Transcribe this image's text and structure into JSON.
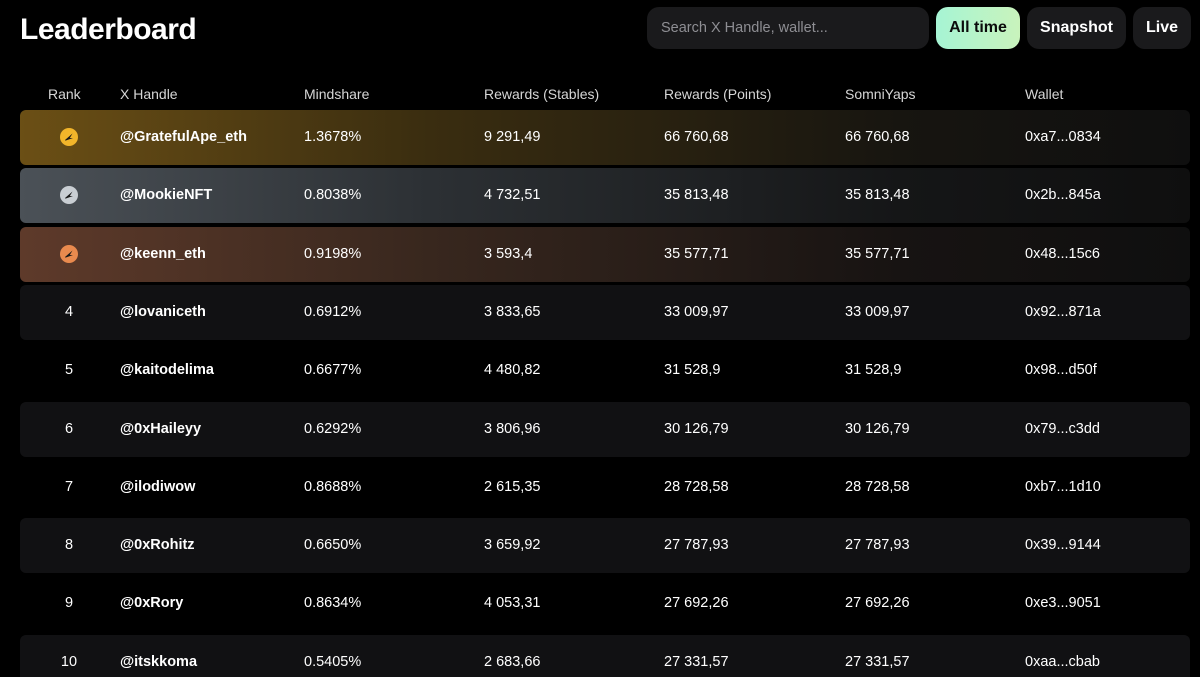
{
  "header": {
    "title": "Leaderboard",
    "search_placeholder": "Search X Handle, wallet...",
    "filters": [
      "All time",
      "Snapshot",
      "Live"
    ],
    "active_filter": "All time"
  },
  "table": {
    "columns": [
      "Rank",
      "X Handle",
      "Mindshare",
      "Rewards (Stables)",
      "Rewards (Points)",
      "SomniYaps",
      "Wallet"
    ],
    "rows": [
      {
        "rank": "1",
        "handle": "@GratefulApe_eth",
        "mindshare": "1.3678%",
        "stables": "9 291,49",
        "points": "66 760,68",
        "yaps": "66 760,68",
        "wallet": "0xa7...0834"
      },
      {
        "rank": "2",
        "handle": "@MookieNFT",
        "mindshare": "0.8038%",
        "stables": "4 732,51",
        "points": "35 813,48",
        "yaps": "35 813,48",
        "wallet": "0x2b...845a"
      },
      {
        "rank": "3",
        "handle": "@keenn_eth",
        "mindshare": "0.9198%",
        "stables": "3 593,4",
        "points": "35 577,71",
        "yaps": "35 577,71",
        "wallet": "0x48...15c6"
      },
      {
        "rank": "4",
        "handle": "@lovaniceth",
        "mindshare": "0.6912%",
        "stables": "3 833,65",
        "points": "33 009,97",
        "yaps": "33 009,97",
        "wallet": "0x92...871a"
      },
      {
        "rank": "5",
        "handle": "@kaitodelima",
        "mindshare": "0.6677%",
        "stables": "4 480,82",
        "points": "31 528,9",
        "yaps": "31 528,9",
        "wallet": "0x98...d50f"
      },
      {
        "rank": "6",
        "handle": "@0xHaileyy",
        "mindshare": "0.6292%",
        "stables": "3 806,96",
        "points": "30 126,79",
        "yaps": "30 126,79",
        "wallet": "0x79...c3dd"
      },
      {
        "rank": "7",
        "handle": "@ilodiwow",
        "mindshare": "0.8688%",
        "stables": "2 615,35",
        "points": "28 728,58",
        "yaps": "28 728,58",
        "wallet": "0xb7...1d10"
      },
      {
        "rank": "8",
        "handle": "@0xRohitz",
        "mindshare": "0.6650%",
        "stables": "3 659,92",
        "points": "27 787,93",
        "yaps": "27 787,93",
        "wallet": "0x39...9144"
      },
      {
        "rank": "9",
        "handle": "@0xRory",
        "mindshare": "0.8634%",
        "stables": "4 053,31",
        "points": "27 692,26",
        "yaps": "27 692,26",
        "wallet": "0xe3...9051"
      },
      {
        "rank": "10",
        "handle": "@itskkoma",
        "mindshare": "0.5405%",
        "stables": "2 683,66",
        "points": "27 331,57",
        "yaps": "27 331,57",
        "wallet": "0xaa...cbab"
      }
    ]
  },
  "medals": [
    {
      "icon": "gold-medal-icon",
      "color": "#f2b52a"
    },
    {
      "icon": "silver-medal-icon",
      "color": "#c9ced3"
    },
    {
      "icon": "bronze-medal-icon",
      "color": "#e98a4e"
    }
  ],
  "colors": {
    "background": "#000000",
    "active_filter_gradient": [
      "#a6f4d4",
      "#c9f3bc"
    ],
    "row_dark": "#111113"
  }
}
